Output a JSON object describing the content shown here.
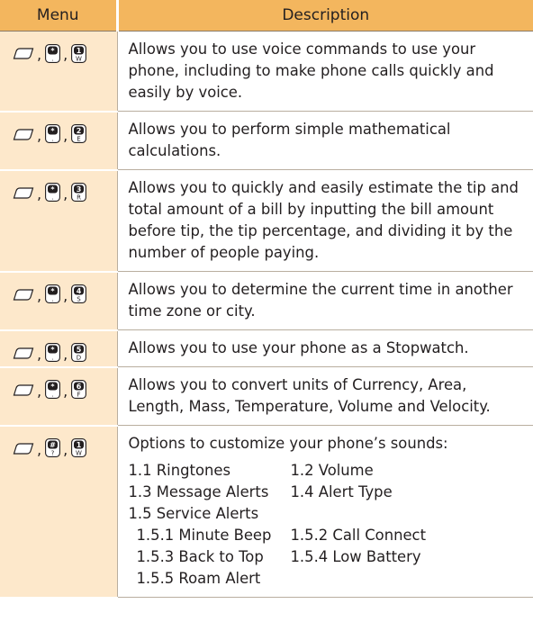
{
  "header": {
    "menu": "Menu",
    "description": "Description"
  },
  "rows": [
    {
      "keys": [
        "menu-softkey",
        "star-key",
        "1-key"
      ],
      "key_labels": [
        "",
        "*",
        "1"
      ],
      "key_sub": [
        "",
        ".",
        "W"
      ],
      "description": "Allows you to use voice commands to use your phone, including to make phone calls quickly and easily by voice."
    },
    {
      "keys": [
        "menu-softkey",
        "star-key",
        "2-key"
      ],
      "key_labels": [
        "",
        "*",
        "2"
      ],
      "key_sub": [
        "",
        ".",
        "E"
      ],
      "description": "Allows you to perform simple mathematical calculations."
    },
    {
      "keys": [
        "menu-softkey",
        "star-key",
        "3-key"
      ],
      "key_labels": [
        "",
        "*",
        "3"
      ],
      "key_sub": [
        "",
        ".",
        "R"
      ],
      "description": "Allows you to quickly and easily estimate the tip and total amount of a bill by inputting the bill amount before tip, the tip percentage, and dividing it by the number of people paying."
    },
    {
      "keys": [
        "menu-softkey",
        "star-key",
        "4-key"
      ],
      "key_labels": [
        "",
        "*",
        "4"
      ],
      "key_sub": [
        "",
        ".",
        "S"
      ],
      "description": "Allows you to determine the current time in another time zone or city."
    },
    {
      "keys": [
        "menu-softkey",
        "star-key",
        "5-key"
      ],
      "key_labels": [
        "",
        "*",
        "5"
      ],
      "key_sub": [
        "",
        ".",
        "D"
      ],
      "description": "Allows you to use your phone as a Stopwatch."
    },
    {
      "keys": [
        "menu-softkey",
        "star-key",
        "6-key"
      ],
      "key_labels": [
        "",
        "*",
        "6"
      ],
      "key_sub": [
        "",
        ".",
        "F"
      ],
      "description": "Allows you to convert units of Currency, Area, Length, Mass, Temperature, Volume and Velocity."
    },
    {
      "keys": [
        "menu-softkey",
        "pound-key",
        "1-key"
      ],
      "key_labels": [
        "",
        "#",
        "1"
      ],
      "key_sub": [
        "",
        "?",
        "W"
      ],
      "description": "Options to customize your phone’s sounds:",
      "options": {
        "o11": "1.1 Ringtones",
        "o12": "1.2 Volume",
        "o13": "1.3 Message Alerts",
        "o14": "1.4 Alert Type",
        "o15": "1.5 Service Alerts",
        "o151": "1.5.1 Minute Beep",
        "o152": "1.5.2 Call Connect",
        "o153": "1.5.3 Back to Top",
        "o154": "1.5.4 Low Battery",
        "o155": "1.5.5 Roam Alert"
      }
    }
  ],
  "colors": {
    "header_bg": "#f3b65e",
    "key_cell_bg": "#fde8cb",
    "border": "#b9ae9f"
  }
}
